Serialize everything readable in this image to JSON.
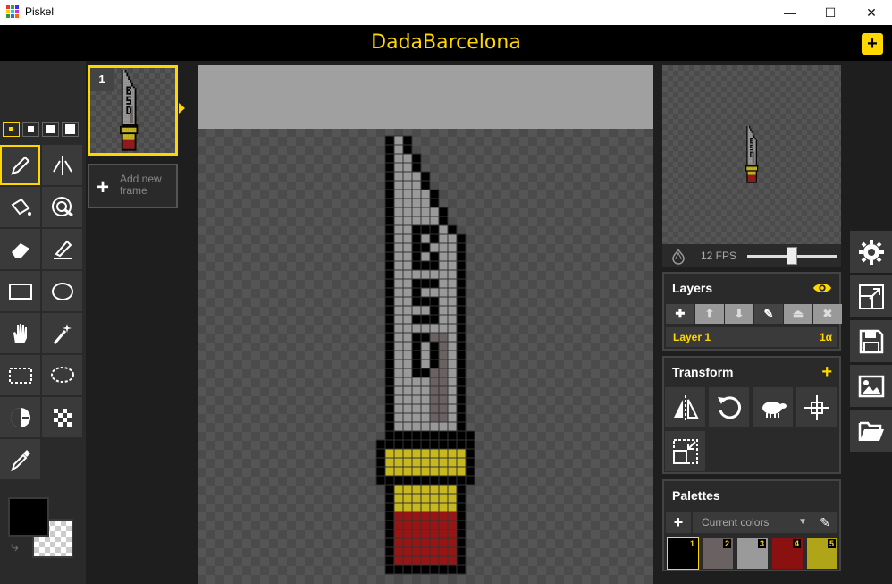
{
  "window": {
    "title": "Piskel",
    "minimize_glyph": "—",
    "maximize_glyph": "☐",
    "close_glyph": "✕"
  },
  "header": {
    "project_title": "DadaBarcelona",
    "new_button_glyph": "+"
  },
  "frames": {
    "items": [
      {
        "number": "1"
      }
    ],
    "add_label": "Add new frame",
    "add_glyph": "+"
  },
  "preview": {
    "fps_label": "12 FPS",
    "fps_value": 12,
    "onion_skin_icon": "onion-icon"
  },
  "layers": {
    "title": "Layers",
    "visibility_icon": "eye-icon",
    "items": [
      {
        "name": "Layer 1",
        "opacity": "1α"
      }
    ],
    "tools": [
      "add",
      "move-up",
      "move-down",
      "edit",
      "merge",
      "delete"
    ]
  },
  "transform": {
    "title": "Transform",
    "add_glyph": "+",
    "tools": [
      "flip-icon",
      "rotate-icon",
      "clone-icon",
      "align-icon",
      "crop-icon"
    ]
  },
  "palettes": {
    "title": "Palettes",
    "selected": "Current colors",
    "add_glyph": "+",
    "colors": [
      {
        "index": "1",
        "hex": "#000000"
      },
      {
        "index": "2",
        "hex": "#6a6262"
      },
      {
        "index": "3",
        "hex": "#9a9a9a"
      },
      {
        "index": "4",
        "hex": "#8b1010"
      },
      {
        "index": "5",
        "hex": "#b0a418"
      }
    ]
  },
  "colors": {
    "primary": "#000000",
    "secondary": "transparent",
    "accent": "#ffd700"
  }
}
